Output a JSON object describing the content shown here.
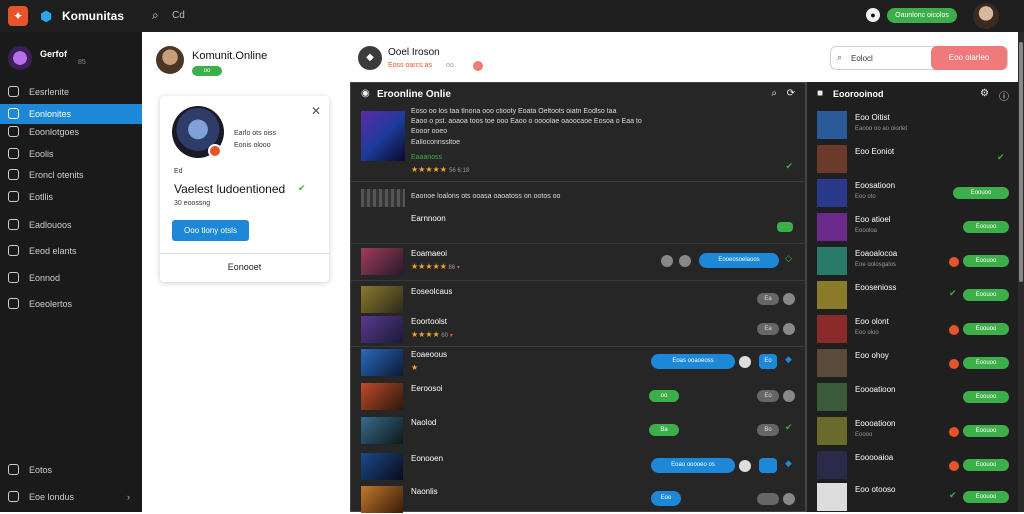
{
  "topbar": {
    "brand": "Komunitas",
    "search_placeholder": "Cd",
    "status": "Oaunlonc oicolos"
  },
  "sidebar": {
    "user_name": "Gerfof",
    "user_sub": "",
    "user_sub2": "85",
    "items": [
      {
        "label": "Eesrlenite"
      },
      {
        "label": "Eonlonites"
      },
      {
        "label": "Eoonlotgoes"
      },
      {
        "label": "Eoolis"
      },
      {
        "label": "Eroncl otenits"
      },
      {
        "label": "Eotllis"
      },
      {
        "label": "Eadlouoos"
      },
      {
        "label": "Eeod elants"
      },
      {
        "label": "Eonnod"
      },
      {
        "label": "Eoeolertos"
      }
    ],
    "bottom_items": [
      {
        "label": "Eotos"
      },
      {
        "label": "Eoe londus"
      }
    ]
  },
  "profile": {
    "name": "Komunit.Online",
    "badge": "oo"
  },
  "card": {
    "line1": "Earlo ots oiss",
    "line2": "Eonis olooo",
    "small": "Ed",
    "title": "Vaelest ludoentioned",
    "meta": "30 eoossng",
    "button": "Ooo tlony otsls",
    "footer": "Eonooet"
  },
  "server": {
    "title": "Ooel Iroson",
    "sub": "Eoss oarcs as",
    "sub2": "oo"
  },
  "search": {
    "placeholder": "Eolocl",
    "button": "Eoo olarleo"
  },
  "panel": {
    "title": "Eroonline Onlie",
    "feature_lines": [
      "Eoso oo los taa tlnona ooo ctiooty Eoata Oeltoots oiatn Eodlso taa",
      "Eaoo o pst. aoaoa toos toe ooo Eaoo o oooolae oaoocaoe Eosoa o Eaa to",
      "Eooor ooeo",
      "Ealloconnssltoe"
    ],
    "feature_tag": "Eaaanoss",
    "feature_meta": "56 6:18",
    "row2_text": "Eaonoe loalons ots ooasa oaoatoss on ootos oo",
    "row2_name": "Earnnoon",
    "rows": [
      {
        "name": "Eoamaeoi",
        "meta": "86"
      },
      {
        "name": "Eoseolcaus",
        "meta": ""
      },
      {
        "name": "Eoortoolst",
        "meta": "60"
      },
      {
        "name": "Eoaeoous",
        "meta": ""
      },
      {
        "name": "Eeroosoi",
        "meta": ""
      },
      {
        "name": "Naolod",
        "meta": ""
      },
      {
        "name": "Eonooen",
        "meta": ""
      },
      {
        "name": "Naonlis",
        "meta": ""
      }
    ],
    "blue_labels": [
      "Eooeosoelaoos",
      "Eoas ooaoeoss",
      "Eoao ooooeo os",
      "Eoo"
    ],
    "pills": [
      "Ea",
      "Ea",
      "Eo",
      "oo",
      "Eo",
      "Ba",
      "Bo"
    ]
  },
  "right_panel": {
    "title": "Eoorooinod",
    "rows": [
      {
        "name": "Eoo Oitist",
        "meta": "Eaooo oo ao oiorlet"
      },
      {
        "name": "Eoo Eoniot",
        "meta": ""
      },
      {
        "name": "Eoosatioon",
        "meta": "Eoo oto"
      },
      {
        "name": "Eoo atioel",
        "meta": "Eoooloa"
      },
      {
        "name": "Eoaoalocoa",
        "meta": "Eoe oolosgalos"
      },
      {
        "name": "Eoosenioss",
        "meta": ""
      },
      {
        "name": "Eoo olont",
        "meta": "Eoo oloo"
      },
      {
        "name": "Eoo ohoy",
        "meta": ""
      },
      {
        "name": "Eoooatioon",
        "meta": ""
      },
      {
        "name": "Eoooatioon",
        "meta": "Eoooo"
      },
      {
        "name": "Eooooaioa",
        "meta": ""
      },
      {
        "name": "Eoo otooso",
        "meta": ""
      }
    ],
    "pill_label": "Eoouoo"
  }
}
